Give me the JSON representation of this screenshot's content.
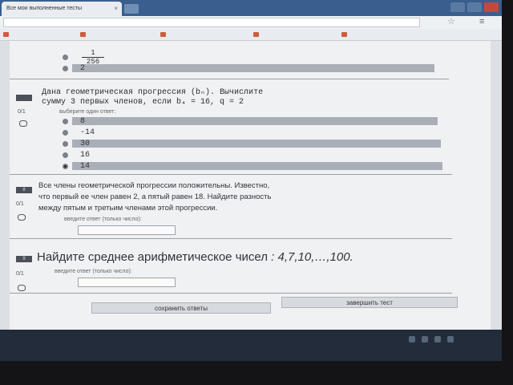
{
  "browser": {
    "tab_title": "Все мои выполненные тесты",
    "address": "",
    "bookmarks": [
      "",
      "",
      "",
      "",
      ""
    ]
  },
  "prev_question": {
    "fraction_numerator": "1",
    "fraction_denominator": "256",
    "last_option": "2"
  },
  "q7": {
    "number": "",
    "text_line1": "Дана геометрическая прогрессия (bₙ). Вычислите",
    "text_line2": "сумму 3 первых членов, если b₄ = 16, q = 2",
    "score": "0/1",
    "instruction": "выберите один ответ:",
    "options": [
      "8",
      "-14",
      "30",
      "16",
      "14"
    ],
    "selected_index": 4
  },
  "q8": {
    "number": "8",
    "text_line1": "Все члены геометрической прогрессии положительны. Известно,",
    "text_line2": "что первый ее член равен 2, а пятый равен 18. Найдите разность",
    "text_line3": "между пятым и третьим членами этой прогрессии.",
    "score": "0/1",
    "input_label": "введите ответ (только число):"
  },
  "q9": {
    "number": "9",
    "text": "Найдите среднее арифметическое чисел",
    "sequence": ": 4,7,10,…,100.",
    "score": "0/1",
    "input_label": "введите ответ (только число):"
  },
  "actions": {
    "save": "сохранить ответы",
    "finish": "завершить тест"
  },
  "taskbar": {
    "status": "",
    "time": "",
    "date": ""
  }
}
